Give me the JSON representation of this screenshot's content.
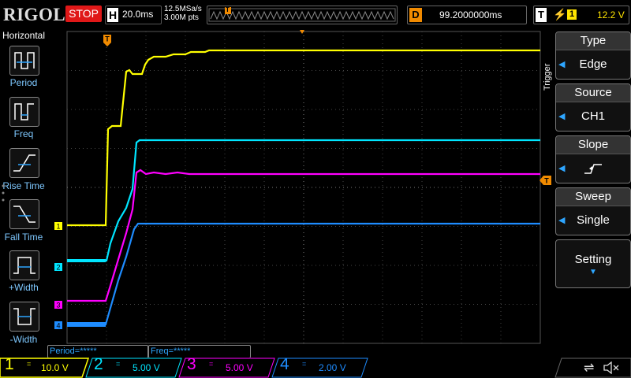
{
  "topbar": {
    "brand": "RIGOL",
    "run_state": "STOP",
    "timebase_label": "H",
    "timebase": "20.0ms",
    "sample_rate": "12.5MSa/s",
    "memory_depth": "3.00M pts",
    "mem_marker": "T",
    "delay_label": "D",
    "delay": "99.2000000ms",
    "trig_label": "T",
    "trig_slope_icon": "rising-edge-icon",
    "trig_channel": "1",
    "trig_level": "12.2 V"
  },
  "left_panel": {
    "title": "Horizontal",
    "items": [
      {
        "label": "Period",
        "icon": "period-icon"
      },
      {
        "label": "Freq",
        "icon": "freq-icon"
      },
      {
        "label": "Rise Time",
        "icon": "rise-time-icon"
      },
      {
        "label": "Fall Time",
        "icon": "fall-time-icon"
      },
      {
        "label": "+Width",
        "icon": "pos-width-icon"
      },
      {
        "label": "-Width",
        "icon": "neg-width-icon"
      }
    ]
  },
  "right_menu": {
    "title": "Trigger",
    "items": [
      {
        "key": "Type",
        "value": "Edge"
      },
      {
        "key": "Source",
        "value": "CH1"
      },
      {
        "key": "Slope",
        "value": "rising-edge-icon"
      },
      {
        "key": "Sweep",
        "value": "Single"
      },
      {
        "key": "Setting",
        "value": ""
      }
    ]
  },
  "measurements": {
    "period": "Period=*****",
    "freq": "Freq=*****"
  },
  "channels": [
    {
      "num": "1",
      "coupling": "=",
      "scale": "10.0 V",
      "color": "#ffff00"
    },
    {
      "num": "2",
      "coupling": "=",
      "scale": "5.00 V",
      "color": "#00e5ff"
    },
    {
      "num": "3",
      "coupling": "=",
      "scale": "5.00 V",
      "color": "#ff00ff"
    },
    {
      "num": "4",
      "coupling": "=",
      "scale": "2.00 V",
      "color": "#1e8cff"
    }
  ],
  "trace_labels": [
    "1",
    "2",
    "3",
    "4"
  ],
  "trigger_level_marker": "T",
  "trigger_position_marker": "T",
  "colors": {
    "ch1": "#ffff00",
    "ch2": "#00e5ff",
    "ch3": "#ff00ff",
    "ch4": "#1e8cff",
    "trigger": "#f08a00",
    "stop": "#e01818"
  }
}
